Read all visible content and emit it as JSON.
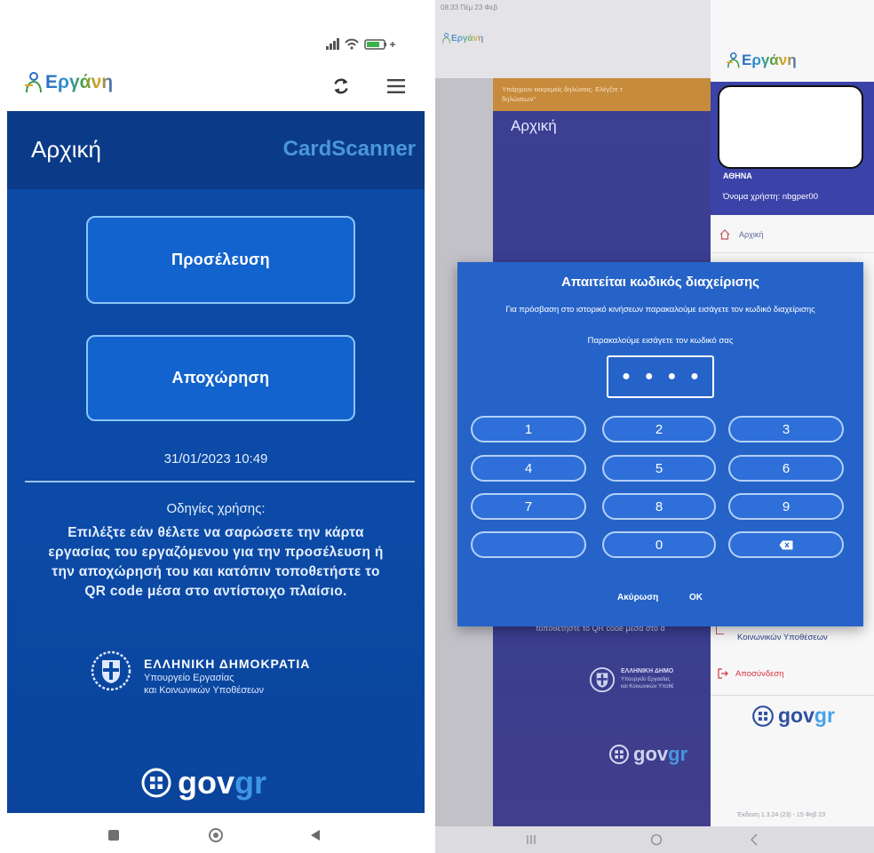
{
  "left_phone": {
    "logo": "Εργάνη",
    "page_title": "Αρχική",
    "scanner_label": "CardScanner",
    "checkin_button": "Προσέλευση",
    "checkout_button": "Αποχώρηση",
    "datetime": "31/01/2023 10:49",
    "instructions_title": "Οδηγίες χρήσης:",
    "instructions_lines": [
      "Επιλέξτε εάν θέλετε να σαρώσετε την κάρτα",
      "εργασίας του εργαζόμενου για την προσέλευση ή",
      "την αποχώρησή του και κατόπιν τοποθετήστε το",
      "QR code μέσα στο αντίστοιχο πλαίσιο."
    ],
    "emblem": {
      "line1": "ΕΛΛΗΝΙΚΗ ΔΗΜΟΚΡΑΤΙΑ",
      "line2": "Υπουργείο Εργασίας",
      "line3": "και Κοινωνικών Υποθέσεων"
    },
    "govgr": {
      "part1": "gov",
      "part2": "gr"
    },
    "icons": [
      "ergani-logo-icon",
      "refresh-icon",
      "menu-icon",
      "greek-emblem-icon",
      "govgr-icon",
      "recents-icon",
      "home-icon",
      "back-icon"
    ]
  },
  "right_tablet": {
    "status_time": "08:33 Πέμ 23 Φεβ",
    "bg_logo": "Εργάνη",
    "bg_banner_lines": [
      "Υπάρχουν εκκρεμείς δηλώσεις. Ελέγξτε τ",
      "δηλώσεων\""
    ],
    "bg_title": "Αρχική",
    "bg_instruction": "τοποθετήστε το QR code μέσα στο α",
    "bg_emblem": {
      "line1": "ΕΛΛΗΝΙΚΗ ΔΗΜΟ",
      "line2": "Υπουργείο Εργασίας",
      "line3": "και Κοινωνικών Υποθέ"
    },
    "bg_govgr": {
      "part1": "gov",
      "part2": "gr"
    },
    "drawer": {
      "logo": "Εργάνη",
      "city": "ΑΘΗΝΑ",
      "username": "Όνομα χρήστη: nbgper00",
      "menu": {
        "home": "Αρχική",
        "social_affairs": "Κοινωνικών Υποθέσεων",
        "logout": "Αποσύνδεση"
      },
      "govgr": {
        "part1": "gov",
        "part2": "gr"
      },
      "version": "Έκδοση 1.3.24 (23) - 15 Φεβ 23"
    },
    "dialog": {
      "title": "Απαιτείται κωδικός διαχείρισης",
      "message": "Για πρόσβαση στο ιστορικό κινήσεων παρακαλούμε εισάγετε τον κωδικό διαχείρισης",
      "prompt": "Παρακαλούμε εισάγετε τον κωδικό σας",
      "pin_masked": "●●●●",
      "keys": [
        "1",
        "2",
        "3",
        "4",
        "5",
        "6",
        "7",
        "8",
        "9",
        "0"
      ],
      "cancel": "Ακύρωση",
      "ok": "OK"
    }
  },
  "colors": {
    "primary_blue": "#0b4aa6",
    "header_blue": "#0b3b88",
    "button_blue": "#1263cd",
    "button_border": "#8cc4f8",
    "scanner_label": "#4a96dc",
    "dialog_blue": "#2663c8",
    "drawer_header": "#3b43a9",
    "banner_orange": "#c78b3c",
    "logout_red": "#d9343c"
  }
}
